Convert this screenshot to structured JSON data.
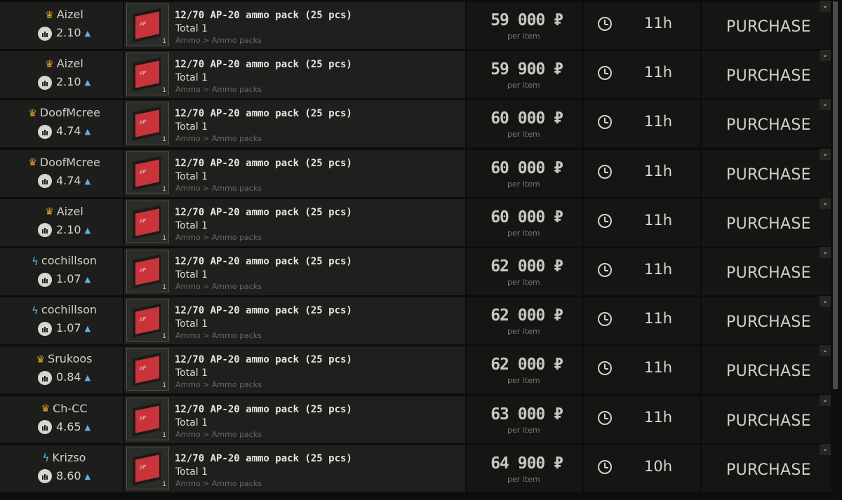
{
  "listing": {
    "rows": [
      {
        "seller": "Aizel",
        "seller_icon": "crown-icon",
        "rating": "2.10",
        "item_name": "12/70 AP-20 ammo pack (25 pcs)",
        "total": "Total 1",
        "category": "Ammo > Ammo packs",
        "stack": "1",
        "price": "59 000",
        "unit": "per item",
        "time": "11h",
        "action": "PURCHASE"
      },
      {
        "seller": "Aizel",
        "seller_icon": "crown-icon",
        "rating": "2.10",
        "item_name": "12/70 AP-20 ammo pack (25 pcs)",
        "total": "Total 1",
        "category": "Ammo > Ammo packs",
        "stack": "1",
        "price": "59 900",
        "unit": "per item",
        "time": "11h",
        "action": "PURCHASE"
      },
      {
        "seller": "DoofMcree",
        "seller_icon": "crown-icon",
        "rating": "4.74",
        "item_name": "12/70 AP-20 ammo pack (25 pcs)",
        "total": "Total 1",
        "category": "Ammo > Ammo packs",
        "stack": "1",
        "price": "60 000",
        "unit": "per item",
        "time": "11h",
        "action": "PURCHASE"
      },
      {
        "seller": "DoofMcree",
        "seller_icon": "crown-icon",
        "rating": "4.74",
        "item_name": "12/70 AP-20 ammo pack (25 pcs)",
        "total": "Total 1",
        "category": "Ammo > Ammo packs",
        "stack": "1",
        "price": "60 000",
        "unit": "per item",
        "time": "11h",
        "action": "PURCHASE"
      },
      {
        "seller": "Aizel",
        "seller_icon": "crown-icon",
        "rating": "2.10",
        "item_name": "12/70 AP-20 ammo pack (25 pcs)",
        "total": "Total 1",
        "category": "Ammo > Ammo packs",
        "stack": "1",
        "price": "60 000",
        "unit": "per item",
        "time": "11h",
        "action": "PURCHASE"
      },
      {
        "seller": "cochillson",
        "seller_icon": "lightning-icon",
        "rating": "1.07",
        "item_name": "12/70 AP-20 ammo pack (25 pcs)",
        "total": "Total 1",
        "category": "Ammo > Ammo packs",
        "stack": "1",
        "price": "62 000",
        "unit": "per item",
        "time": "11h",
        "action": "PURCHASE"
      },
      {
        "seller": "cochillson",
        "seller_icon": "lightning-icon",
        "rating": "1.07",
        "item_name": "12/70 AP-20 ammo pack (25 pcs)",
        "total": "Total 1",
        "category": "Ammo > Ammo packs",
        "stack": "1",
        "price": "62 000",
        "unit": "per item",
        "time": "11h",
        "action": "PURCHASE"
      },
      {
        "seller": "Srukoos",
        "seller_icon": "crown-icon",
        "rating": "0.84",
        "item_name": "12/70 AP-20 ammo pack (25 pcs)",
        "total": "Total 1",
        "category": "Ammo > Ammo packs",
        "stack": "1",
        "price": "62 000",
        "unit": "per item",
        "time": "11h",
        "action": "PURCHASE"
      },
      {
        "seller": "Ch-CC",
        "seller_icon": "crown-icon",
        "rating": "4.65",
        "item_name": "12/70 AP-20 ammo pack (25 pcs)",
        "total": "Total 1",
        "category": "Ammo > Ammo packs",
        "stack": "1",
        "price": "63 000",
        "unit": "per item",
        "time": "11h",
        "action": "PURCHASE"
      },
      {
        "seller": "Krizso",
        "seller_icon": "lightning-icon",
        "rating": "8.60",
        "item_name": "12/70 AP-20 ammo pack (25 pcs)",
        "total": "Total 1",
        "category": "Ammo > Ammo packs",
        "stack": "1",
        "price": "64 900",
        "unit": "per item",
        "time": "10h",
        "action": "PURCHASE"
      }
    ]
  },
  "currency_symbol": "₽",
  "colors": {
    "crown": "#e2a12d",
    "lightning": "#5fb4e6",
    "rating_up": "#5fb4e6",
    "red_pack": "#c9333a"
  }
}
